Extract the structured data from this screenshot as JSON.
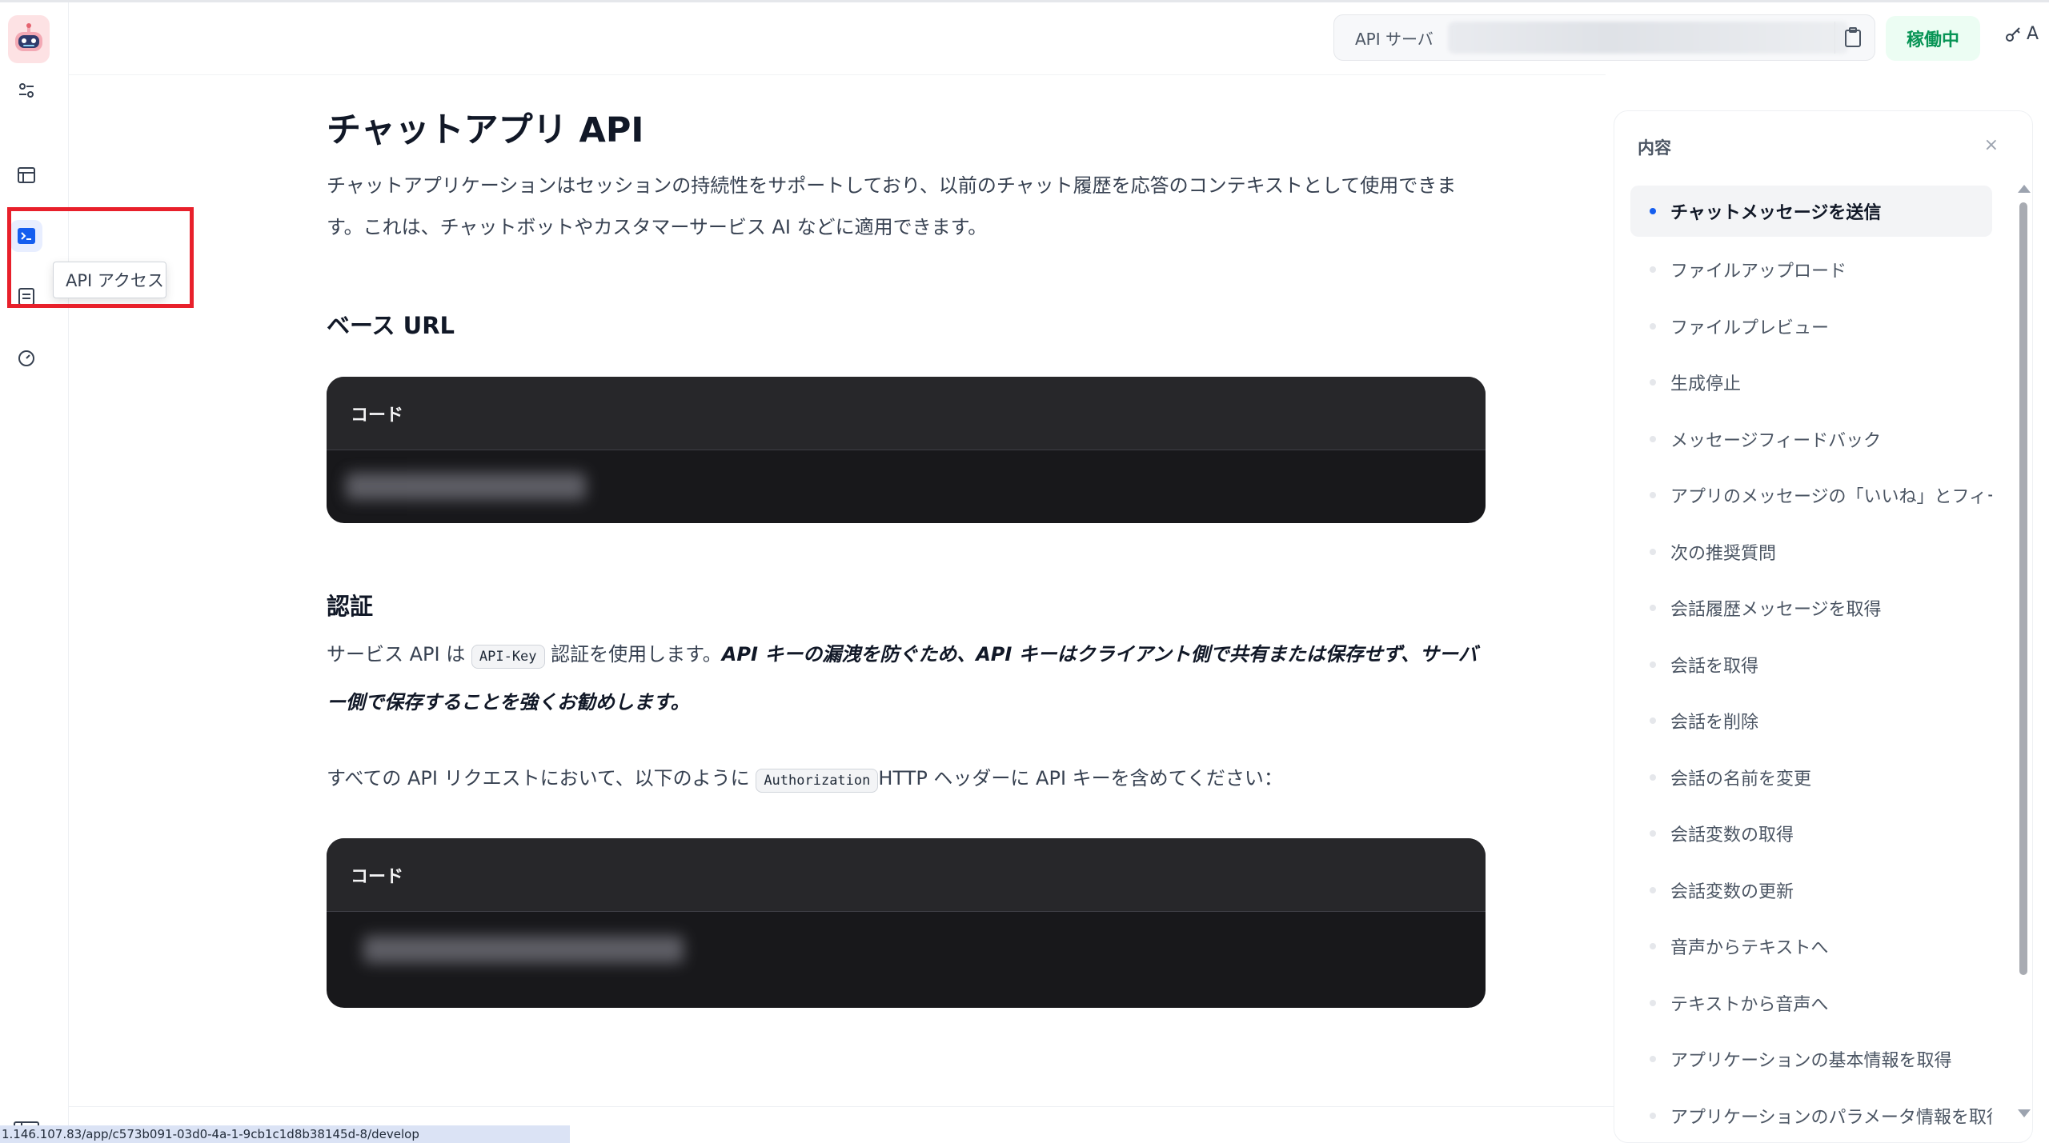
{
  "header": {
    "api_server_label": "API サーバ",
    "status": "稼働中",
    "api_key_label": "A"
  },
  "sidebar": {
    "tooltip": "API アクセス",
    "items": [
      {
        "icon": "sliders-icon"
      },
      {
        "icon": "browser-window-icon"
      },
      {
        "icon": "terminal-icon"
      },
      {
        "icon": "document-list-icon"
      },
      {
        "icon": "gauge-icon"
      }
    ]
  },
  "main": {
    "title": "チャットアプリ API",
    "intro": "チャットアプリケーションはセッションの持続性をサポートしており、以前のチャット履歴を応答のコンテキストとして使用できます。これは、チャットボットやカスタマーサービス AI などに適用できます。",
    "base_url_title": "ベース URL",
    "code_label": "コード",
    "auth_title": "認証",
    "auth_text_1": "サービス API は",
    "auth_code": "API-Key",
    "auth_text_2": "認証を使用します。",
    "auth_emphasis": "API キーの漏洩を防ぐため、API キーはクライアント側で共有または保存せず、サーバー側で保存することを強くお勧めします。",
    "header_text_1": "すべての API リクエストにおいて、以下のように",
    "header_code": "Authorization",
    "header_text_2": "HTTP ヘッダーに API キーを含めてください：",
    "code_label_2": "コード"
  },
  "toc": {
    "title": "内容",
    "close": "×",
    "items": [
      "チャットメッセージを送信",
      "ファイルアップロード",
      "ファイルプレビュー",
      "生成停止",
      "メッセージフィードバック",
      "アプリのメッセージの「いいね」とフィード...",
      "次の推奨質問",
      "会話履歴メッセージを取得",
      "会話を取得",
      "会話を削除",
      "会話の名前を変更",
      "会話変数の取得",
      "会話変数の更新",
      "音声からテキストへ",
      "テキストから音声へ",
      "アプリケーションの基本情報を取得",
      "アプリケーションのパラメータ情報を取得"
    ]
  },
  "status_bar_url": "1.146.107.83/app/c573b091-03d0-4a-1-9cb1c1d8b38145d-8/develop",
  "colors": {
    "accent": "#155eef",
    "status_green": "#079455",
    "highlight_red": "#e8202b"
  }
}
